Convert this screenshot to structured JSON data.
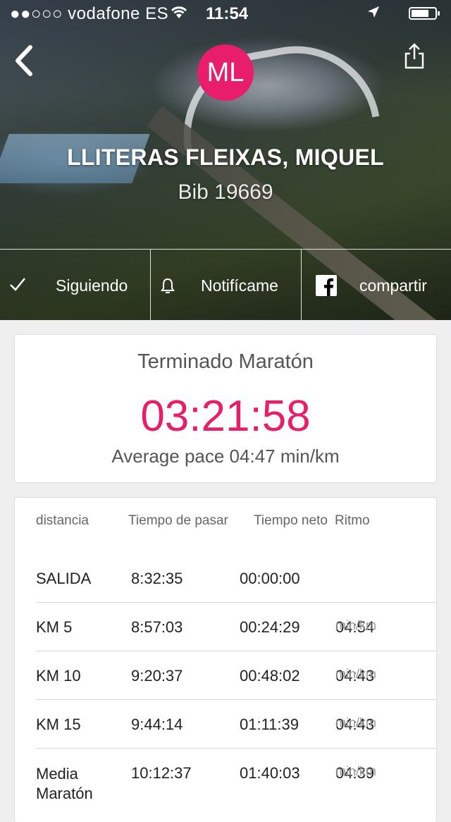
{
  "status_bar": {
    "carrier": "●●○○○ vodafone ES",
    "time": "11:54"
  },
  "header": {
    "avatar_initials": "ML",
    "name": "LLITERAS FLEIXAS, MIQUEL",
    "bib": "Bib 19669"
  },
  "actions": {
    "follow_label": "Siguiendo",
    "notify_label": "Notifícame",
    "share_label": "compartir"
  },
  "result": {
    "status": "Terminado Maratón",
    "time": "03:21:58",
    "average_pace": "Average pace 04:47 min/km"
  },
  "splits": {
    "headers": {
      "distance": "distancia",
      "pass_time": "Tiempo de pasar",
      "net_time": "Tiempo neto",
      "pace": "Ritmo"
    },
    "rows": [
      {
        "name": "SALIDA",
        "pass": "8:32:35",
        "net": "00:00:00",
        "pace": "",
        "unit": ""
      },
      {
        "name": "KM 5",
        "pass": "8:57:03",
        "net": "00:24:29",
        "pace": "04:54",
        "unit": "min/km"
      },
      {
        "name": "KM 10",
        "pass": "9:20:37",
        "net": "00:48:02",
        "pace": "04:43",
        "unit": "min/km"
      },
      {
        "name": "KM 15",
        "pass": "9:44:14",
        "net": "01:11:39",
        "pace": "04:43",
        "unit": "min/km"
      },
      {
        "name": "Media",
        "name2": "Maratón",
        "pass": "10:12:37",
        "net": "01:40:03",
        "pace": "04:39",
        "unit": "min/km"
      }
    ]
  },
  "colors": {
    "accent": "#e91e6a",
    "background": "#efefef"
  },
  "icons": [
    "back-arrow-icon",
    "share-icon",
    "wifi-icon",
    "location-arrow-icon",
    "battery-icon",
    "checkmark-icon",
    "bell-icon",
    "facebook-icon"
  ]
}
